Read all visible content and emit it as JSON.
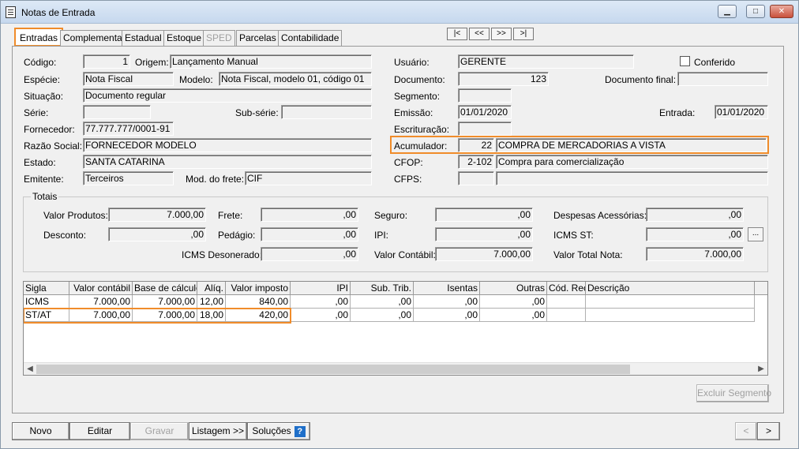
{
  "window": {
    "title": "Notas de Entrada",
    "min_icon": "minimize-icon",
    "max_icon": "maximize-icon",
    "close_icon": "close-icon"
  },
  "tabs": [
    {
      "label": "Entradas",
      "active": true
    },
    {
      "label": "Complementar"
    },
    {
      "label": "Estadual"
    },
    {
      "label": "Estoque"
    },
    {
      "label": "SPED",
      "disabled": true
    },
    {
      "label": "Parcelas"
    },
    {
      "label": "Contabilidade"
    }
  ],
  "nav": {
    "first": "|<",
    "prev": "<<",
    "next": ">>",
    "last": ">|"
  },
  "form": {
    "codigo_label": "Código:",
    "codigo": "1",
    "origem_label": "Origem:",
    "origem": "Lançamento Manual",
    "especie_label": "Espécie:",
    "especie": "Nota Fiscal",
    "modelo_label": "Modelo:",
    "modelo": "Nota Fiscal, modelo 01, código 01",
    "situacao_label": "Situação:",
    "situacao": "Documento regular",
    "serie_label": "Série:",
    "serie": "",
    "subserie_label": "Sub-série:",
    "subserie": "",
    "fornecedor_label": "Fornecedor:",
    "fornecedor": "77.777.777/0001-91",
    "razao_label": "Razão Social:",
    "razao": "FORNECEDOR MODELO",
    "estado_label": "Estado:",
    "estado": "SANTA CATARINA",
    "emitente_label": "Emitente:",
    "emitente": "Terceiros",
    "frete_label": "Mod. do frete:",
    "frete": "CIF",
    "usuario_label": "Usuário:",
    "usuario": "GERENTE",
    "conferido_label": "Conferido",
    "documento_label": "Documento:",
    "documento": "123",
    "docfinal_label": "Documento final:",
    "docfinal": "",
    "segmento_label": "Segmento:",
    "segmento": "",
    "emissao_label": "Emissão:",
    "emissao": "01/01/2020",
    "entrada_label": "Entrada:",
    "entrada": "01/01/2020",
    "escrituracao_label": "Escrituração:",
    "escrituracao": "",
    "acumulador_label": "Acumulador:",
    "acumulador_code": "22",
    "acumulador_desc": "COMPRA DE MERCADORIAS A VISTA",
    "cfop_label": "CFOP:",
    "cfop_code": "2-102",
    "cfop_desc": "Compra para comercialização",
    "cfps_label": "CFPS:",
    "cfps_code": "",
    "cfps_desc": ""
  },
  "totais": {
    "title": "Totais",
    "valor_produtos_label": "Valor Produtos:",
    "valor_produtos": "7.000,00",
    "frete_label": "Frete:",
    "frete": ",00",
    "seguro_label": "Seguro:",
    "seguro": ",00",
    "despesas_label": "Despesas Acessórias:",
    "despesas": ",00",
    "desconto_label": "Desconto:",
    "desconto": ",00",
    "pedagio_label": "Pedágio:",
    "pedagio": ",00",
    "ipi_label": "IPI:",
    "ipi": ",00",
    "icms_st_label": "ICMS ST:",
    "icms_st": ",00",
    "icms_st_btn": "...",
    "icms_desonerado_label": "ICMS Desonerado:",
    "icms_desonerado": ",00",
    "valor_contabil_label": "Valor Contábil:",
    "valor_contabil": "7.000,00",
    "valor_total_label": "Valor Total Nota:",
    "valor_total": "7.000,00"
  },
  "grid": {
    "columns": [
      "Sigla",
      "Valor contábil",
      "Base de cálculo",
      "Alíq.",
      "Valor imposto",
      "IPI",
      "Sub. Trib.",
      "Isentas",
      "Outras",
      "Cód. Rec.",
      "Descrição"
    ],
    "rows": [
      [
        "ICMS",
        "7.000,00",
        "7.000,00",
        "12,00",
        "840,00",
        ",00",
        ",00",
        ",00",
        ",00",
        "",
        ""
      ],
      [
        "ST/AT",
        "7.000,00",
        "7.000,00",
        "18,00",
        "420,00",
        ",00",
        ",00",
        ",00",
        ",00",
        "",
        ""
      ]
    ],
    "excluir_label": "Excluir Segmento"
  },
  "footer": {
    "novo": "Novo",
    "editar": "Editar",
    "gravar": "Gravar",
    "listagem": "Listagem >>",
    "solucoes": "Soluções",
    "help": "?",
    "prev": "<",
    "next": ">"
  }
}
